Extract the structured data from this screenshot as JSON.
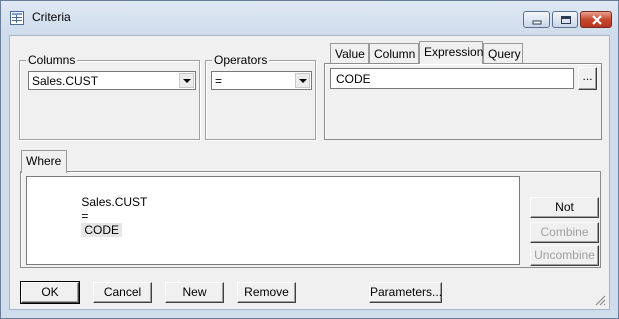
{
  "window": {
    "title": "Criteria"
  },
  "columns": {
    "label": "Columns",
    "value": "Sales.CUST"
  },
  "operators": {
    "label": "Operators",
    "value": "="
  },
  "value_tabs": {
    "tabs": [
      "Value",
      "Column",
      "Expression",
      "Query"
    ],
    "active": "Expression",
    "expression": "CODE",
    "browse_label": "..."
  },
  "where": {
    "tab_label": "Where",
    "clause_field": "Sales.CUST",
    "clause_op": "=",
    "clause_value": "CODE"
  },
  "side_buttons": {
    "not": "Not",
    "combine": "Combine",
    "uncombine": "Uncombine"
  },
  "bottom_buttons": {
    "ok": "OK",
    "cancel": "Cancel",
    "new": "New",
    "remove": "Remove",
    "parameters": "Parameters..."
  }
}
